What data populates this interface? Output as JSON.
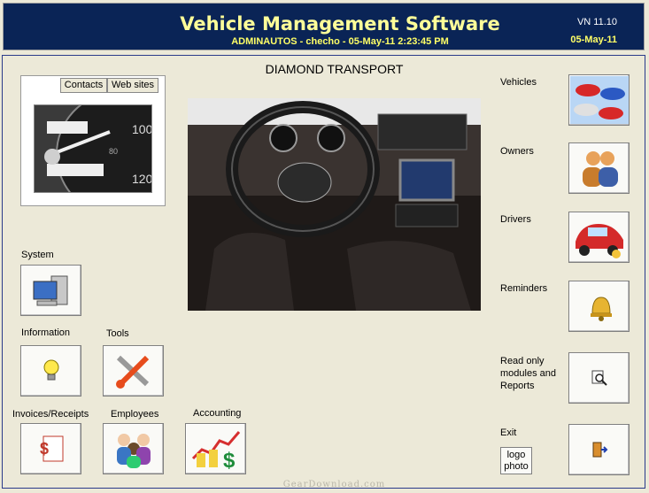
{
  "header": {
    "title": "Vehicle Management Software",
    "subtitle": "ADMINAUTOS - checho - 05-May-11 2:23:45 PM",
    "version": "VN 11.10",
    "date": "05-May-11"
  },
  "company": "DIAMOND TRANSPORT",
  "tabs": [
    "Contacts",
    "Web sites"
  ],
  "left_buttons": {
    "system": "System",
    "information": "Information",
    "tools": "Tools",
    "invoices": "Invoices/Receipts",
    "employees": "Employees",
    "accounting": "Accounting"
  },
  "right_buttons": {
    "vehicles": "Vehicles",
    "owners": "Owners",
    "drivers": "Drivers",
    "reminders": "Reminders",
    "readonly": "Read only modules and Reports",
    "exit": "Exit"
  },
  "logo_button": "logo photo",
  "footer": "GearDownload.com"
}
